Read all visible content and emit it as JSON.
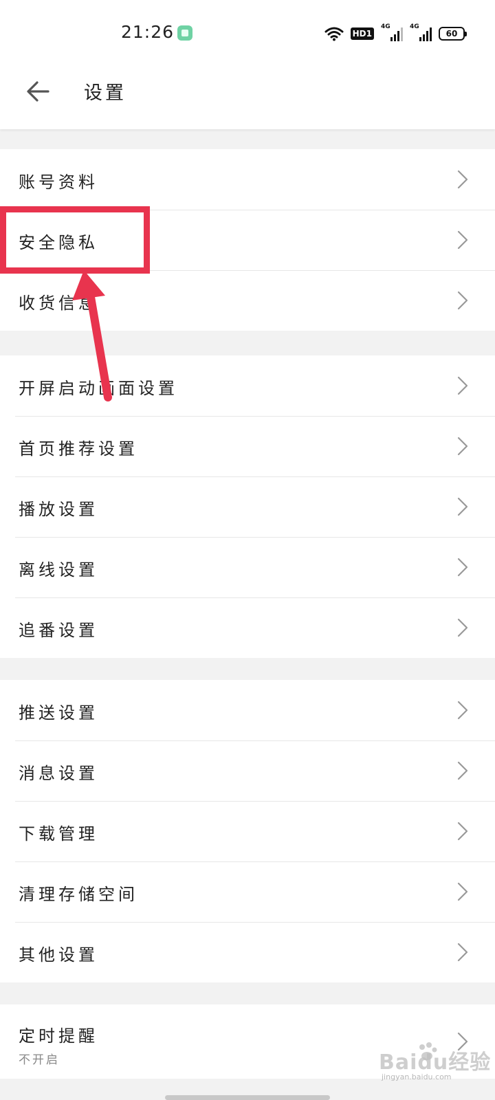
{
  "status_bar": {
    "time": "21:26",
    "hd_badge": "HD1",
    "network_1": "4G",
    "network_2": "4G",
    "battery": "60"
  },
  "header": {
    "title": "设置",
    "back_icon": "arrow-left-icon"
  },
  "groups": [
    {
      "items": [
        {
          "label": "账号资料"
        },
        {
          "label": "安全隐私"
        },
        {
          "label": "收货信息"
        }
      ]
    },
    {
      "items": [
        {
          "label": "开屏启动画面设置"
        },
        {
          "label": "首页推荐设置"
        },
        {
          "label": "播放设置"
        },
        {
          "label": "离线设置"
        },
        {
          "label": "追番设置"
        }
      ]
    },
    {
      "items": [
        {
          "label": "推送设置"
        },
        {
          "label": "消息设置"
        },
        {
          "label": "下载管理"
        },
        {
          "label": "清理存储空间"
        },
        {
          "label": "其他设置"
        }
      ]
    },
    {
      "items": [
        {
          "label": "定时提醒",
          "sub": "不开启"
        }
      ]
    }
  ],
  "annotation": {
    "color": "#e8344e",
    "highlighted_item": "安全隐私"
  },
  "watermark": {
    "text": "Baidu经验",
    "sub": "jingyan.baidu.com"
  }
}
